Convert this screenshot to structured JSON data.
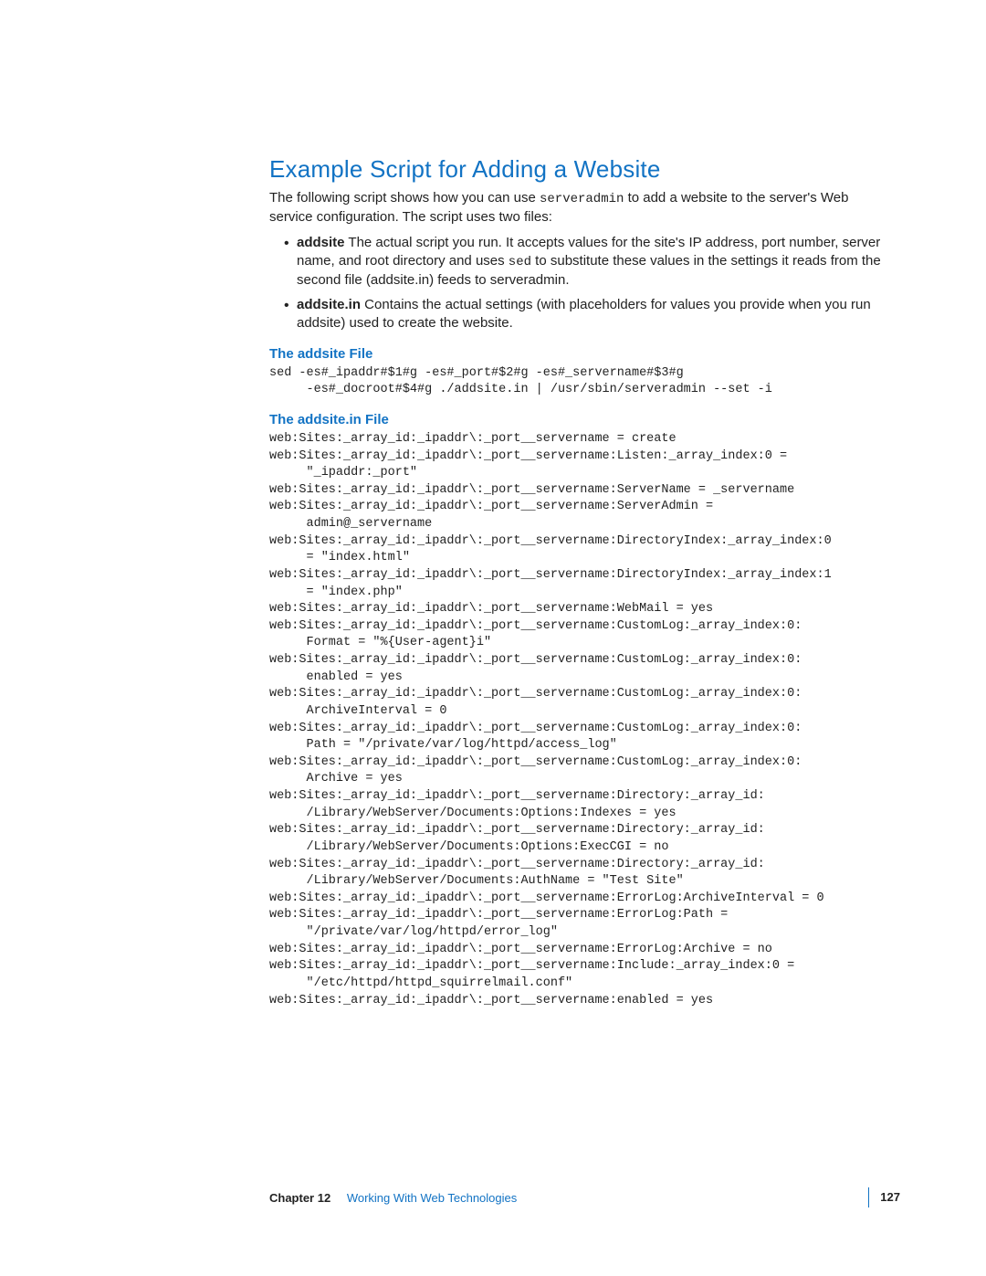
{
  "heading": "Example Script for Adding a Website",
  "intro_parts": {
    "a": "The following script shows how you can use ",
    "cmd": "serveradmin",
    "b": " to add a website to the server's Web service configuration. The script uses two files:"
  },
  "bullets": [
    {
      "name": "addsite",
      "rest_a": "  The actual script you run. It accepts values for the site's IP address, port number, server name, and root directory and uses ",
      "mono": "sed",
      "rest_b": " to substitute these values in the settings it reads from the second file (addsite.in) feeds to serveradmin."
    },
    {
      "name": "addsite.in",
      "rest_a": "  Contains the actual settings (with placeholders for values you provide when you run addsite) used to create the website.",
      "mono": "",
      "rest_b": ""
    }
  ],
  "section1_title": "The addsite File",
  "section1_code": "sed -es#_ipaddr#$1#g -es#_port#$2#g -es#_servername#$3#g\n     -es#_docroot#$4#g ./addsite.in | /usr/sbin/serveradmin --set -i",
  "section2_title": "The addsite.in File",
  "section2_code": "web:Sites:_array_id:_ipaddr\\:_port__servername = create\nweb:Sites:_array_id:_ipaddr\\:_port__servername:Listen:_array_index:0 =\n     \"_ipaddr:_port\"\nweb:Sites:_array_id:_ipaddr\\:_port__servername:ServerName = _servername\nweb:Sites:_array_id:_ipaddr\\:_port__servername:ServerAdmin =\n     admin@_servername\nweb:Sites:_array_id:_ipaddr\\:_port__servername:DirectoryIndex:_array_index:0\n     = \"index.html\"\nweb:Sites:_array_id:_ipaddr\\:_port__servername:DirectoryIndex:_array_index:1\n     = \"index.php\"\nweb:Sites:_array_id:_ipaddr\\:_port__servername:WebMail = yes\nweb:Sites:_array_id:_ipaddr\\:_port__servername:CustomLog:_array_index:0:\n     Format = \"%{User-agent}i\"\nweb:Sites:_array_id:_ipaddr\\:_port__servername:CustomLog:_array_index:0:\n     enabled = yes\nweb:Sites:_array_id:_ipaddr\\:_port__servername:CustomLog:_array_index:0:\n     ArchiveInterval = 0\nweb:Sites:_array_id:_ipaddr\\:_port__servername:CustomLog:_array_index:0:\n     Path = \"/private/var/log/httpd/access_log\"\nweb:Sites:_array_id:_ipaddr\\:_port__servername:CustomLog:_array_index:0:\n     Archive = yes\nweb:Sites:_array_id:_ipaddr\\:_port__servername:Directory:_array_id:\n     /Library/WebServer/Documents:Options:Indexes = yes\nweb:Sites:_array_id:_ipaddr\\:_port__servername:Directory:_array_id:\n     /Library/WebServer/Documents:Options:ExecCGI = no\nweb:Sites:_array_id:_ipaddr\\:_port__servername:Directory:_array_id:\n     /Library/WebServer/Documents:AuthName = \"Test Site\"\nweb:Sites:_array_id:_ipaddr\\:_port__servername:ErrorLog:ArchiveInterval = 0\nweb:Sites:_array_id:_ipaddr\\:_port__servername:ErrorLog:Path =\n     \"/private/var/log/httpd/error_log\"\nweb:Sites:_array_id:_ipaddr\\:_port__servername:ErrorLog:Archive = no\nweb:Sites:_array_id:_ipaddr\\:_port__servername:Include:_array_index:0 =\n     \"/etc/httpd/httpd_squirrelmail.conf\"\nweb:Sites:_array_id:_ipaddr\\:_port__servername:enabled = yes",
  "footer": {
    "chapter_label": "Chapter 12",
    "chapter_title": "Working With Web Technologies",
    "page_number": "127"
  }
}
